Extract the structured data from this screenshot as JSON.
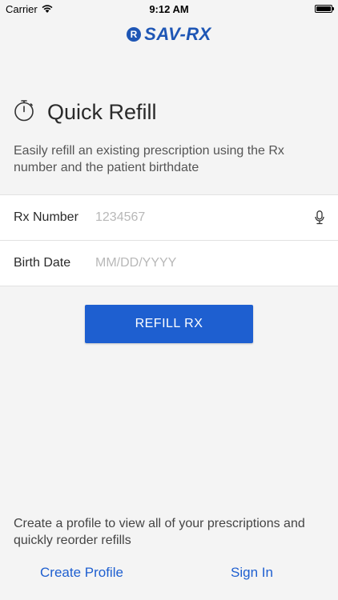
{
  "status_bar": {
    "carrier": "Carrier",
    "time": "9:12 AM",
    "battery_level": 1.0
  },
  "logo": {
    "mark": "R",
    "text": "SAV-RX"
  },
  "header": {
    "title": "Quick Refill",
    "icon": "stopwatch-icon",
    "description": "Easily refill an existing prescription using the Rx number and the patient birthdate"
  },
  "form": {
    "rx_number": {
      "label": "Rx Number",
      "placeholder": "1234567",
      "value": ""
    },
    "birth_date": {
      "label": "Birth Date",
      "placeholder": "MM/DD/YYYY",
      "value": ""
    }
  },
  "actions": {
    "refill_label": "REFILL RX"
  },
  "footer": {
    "text": "Create a profile to view all of your prescriptions and quickly reorder refills",
    "create_profile": "Create Profile",
    "sign_in": "Sign In"
  },
  "colors": {
    "accent": "#1e5fd0",
    "brand": "#1e56b5",
    "background": "#f4f4f4"
  }
}
